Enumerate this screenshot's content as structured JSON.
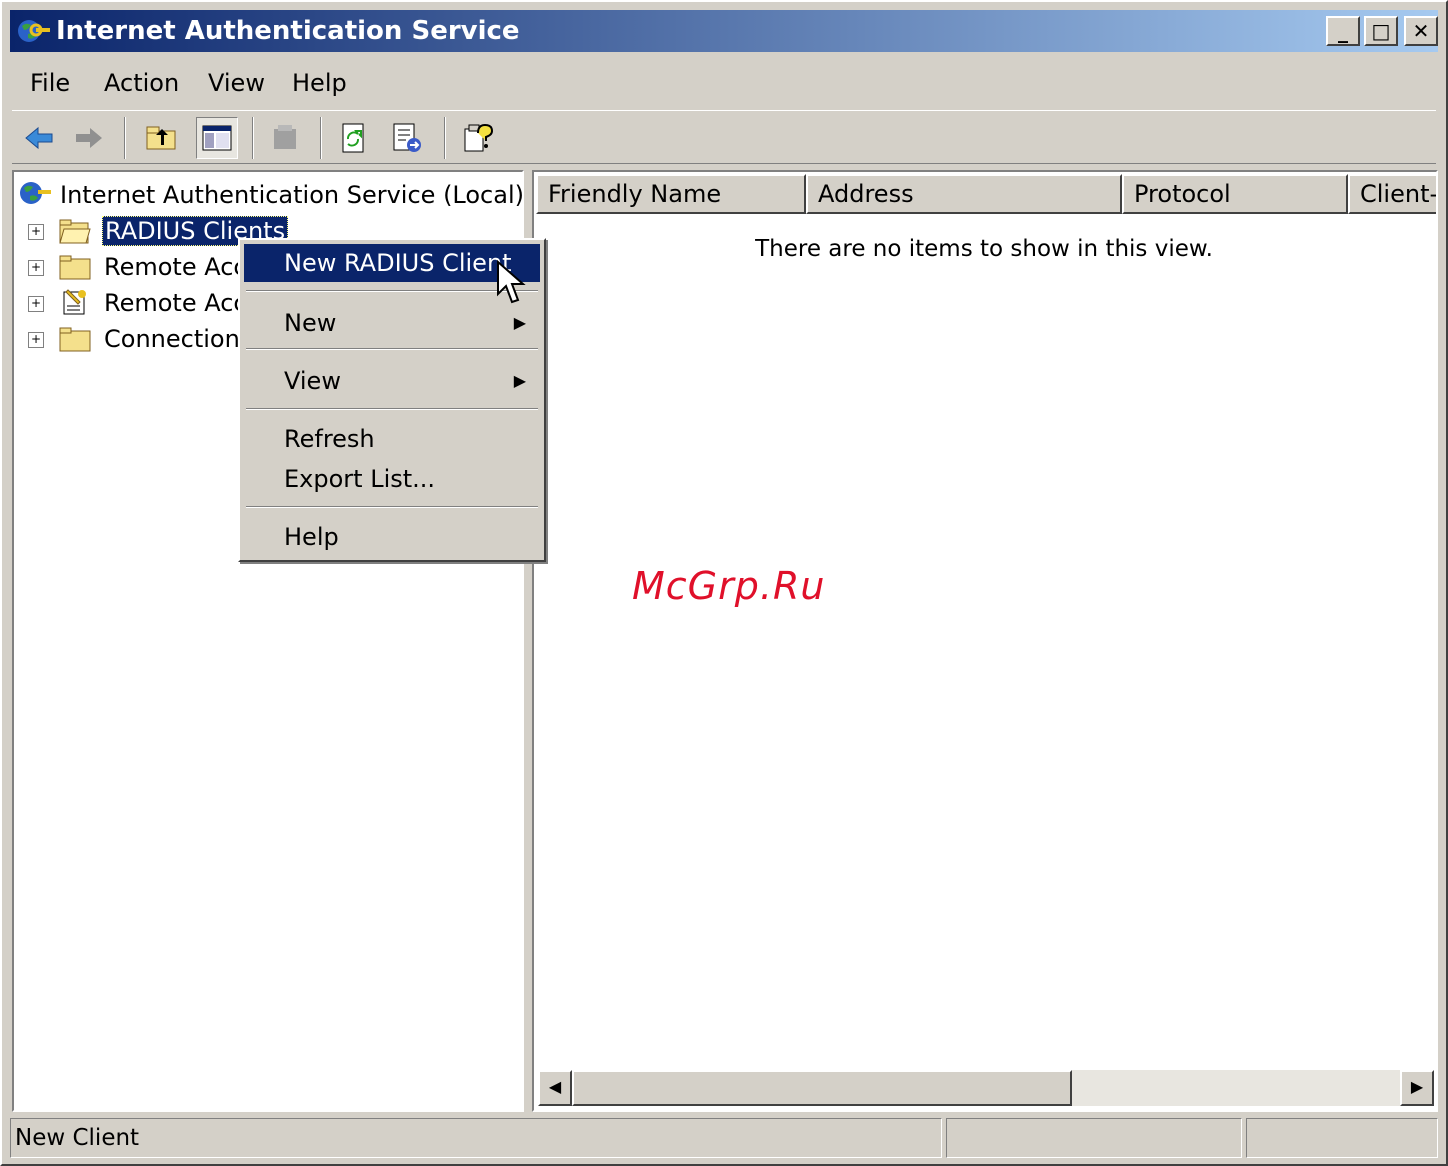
{
  "window": {
    "title": "Internet Authentication Service",
    "controls": {
      "minimize": "_",
      "maximize": "□",
      "close": "✕"
    }
  },
  "menubar": {
    "items": [
      {
        "label": "File"
      },
      {
        "label": "Action"
      },
      {
        "label": "View"
      },
      {
        "label": "Help"
      }
    ]
  },
  "toolbar": {
    "icons": [
      "back-arrow-icon",
      "forward-arrow-icon",
      "up-folder-icon",
      "show-hide-tree-icon",
      "delete-icon",
      "refresh-icon",
      "export-list-icon",
      "help-icon"
    ]
  },
  "tree": {
    "root": "Internet Authentication Service (Local)",
    "children": [
      {
        "label": "RADIUS Clients",
        "selected": true
      },
      {
        "label": "Remote Acce"
      },
      {
        "label": "Remote Acce"
      },
      {
        "label": "Connection F"
      }
    ]
  },
  "list": {
    "columns": [
      "Friendly Name",
      "Address",
      "Protocol",
      "Client-"
    ],
    "empty_message": "There are no items to show in this view."
  },
  "context_menu": {
    "items": [
      {
        "label": "New RADIUS Client",
        "highlighted": true
      },
      {
        "label": "New",
        "submenu": true
      },
      {
        "label": "View",
        "submenu": true
      },
      {
        "label": "Refresh"
      },
      {
        "label": "Export List..."
      },
      {
        "label": "Help"
      }
    ]
  },
  "statusbar": {
    "text": "New Client",
    "pane2": "",
    "pane3": ""
  },
  "watermark": "McGrp.Ru",
  "colors": {
    "title_start": "#0a246a",
    "title_end": "#a6caf0",
    "selection": "#0a246a",
    "face": "#d4d0c8",
    "watermark": "#e0102a"
  }
}
